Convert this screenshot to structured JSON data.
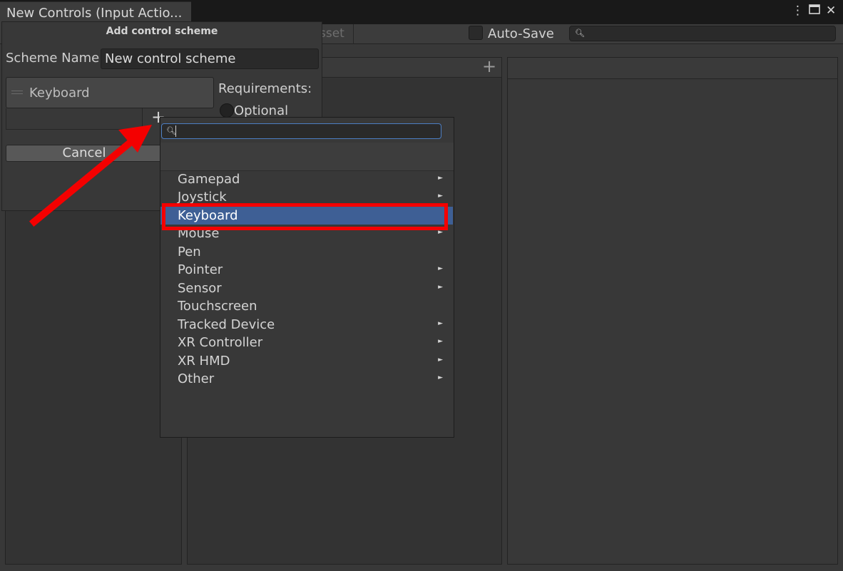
{
  "window": {
    "tab_title": "New Controls (Input Actio...",
    "menu_icon": "vertical-dots-icon",
    "maximize_icon": "maximize-icon",
    "close_icon": "close-icon"
  },
  "toolbar": {
    "save_asset_partial": "sset",
    "auto_save_label": "Auto-Save",
    "auto_save_checked": false,
    "search_placeholder": ""
  },
  "scheme_popup": {
    "title": "Add control scheme",
    "scheme_name_label": "Scheme Name",
    "scheme_name_value": "New control scheme",
    "device_list": [
      "Keyboard"
    ],
    "add_device_symbol": "+",
    "requirements_label": "Requirements:",
    "optional_label": "Optional",
    "cancel_label": "Cancel"
  },
  "pane": {
    "add_symbol": "+"
  },
  "device_menu": {
    "search_value": "",
    "items": [
      {
        "label": "Gamepad",
        "has_submenu": true
      },
      {
        "label": "Joystick",
        "has_submenu": true
      },
      {
        "label": "Keyboard",
        "has_submenu": false,
        "selected": true
      },
      {
        "label": "Mouse",
        "has_submenu": true
      },
      {
        "label": "Pen",
        "has_submenu": false
      },
      {
        "label": "Pointer",
        "has_submenu": true
      },
      {
        "label": "Sensor",
        "has_submenu": true
      },
      {
        "label": "Touchscreen",
        "has_submenu": false
      },
      {
        "label": "Tracked Device",
        "has_submenu": true
      },
      {
        "label": "XR Controller",
        "has_submenu": true
      },
      {
        "label": "XR HMD",
        "has_submenu": true
      },
      {
        "label": "Other",
        "has_submenu": true
      }
    ],
    "submenu_glyph": "►"
  },
  "colors": {
    "selection": "#3e5f95",
    "annotation": "#f40000"
  }
}
